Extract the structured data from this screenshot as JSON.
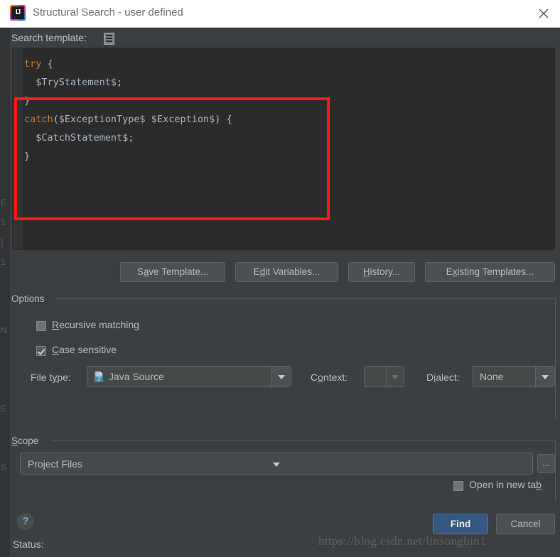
{
  "window": {
    "title": "Structural Search - user defined",
    "logo_alt": "IJ",
    "close_label": "×"
  },
  "search_template": {
    "label": "Search template:",
    "icon": "template-list-icon",
    "code_lines": [
      {
        "segments": [
          {
            "t": "try",
            "c": "kw"
          },
          {
            "t": " {",
            "c": "pn"
          }
        ]
      },
      {
        "segments": [
          {
            "t": "  $TryStatement$",
            "c": "var"
          },
          {
            "t": ";",
            "c": "pn"
          }
        ]
      },
      {
        "segments": [
          {
            "t": "}",
            "c": "pn"
          }
        ]
      },
      {
        "segments": [
          {
            "t": "catch",
            "c": "kw"
          },
          {
            "t": "($ExceptionType$ $Exception$) {",
            "c": "pn"
          }
        ]
      },
      {
        "segments": [
          {
            "t": "  $CatchStatement$",
            "c": "var"
          },
          {
            "t": ";",
            "c": "pn"
          }
        ]
      },
      {
        "segments": [
          {
            "t": "}",
            "c": "pn"
          }
        ]
      }
    ],
    "highlight_color": "#ff1a16"
  },
  "template_buttons": [
    {
      "pre": "S",
      "mnemonic": "a",
      "post": "ve Template..."
    },
    {
      "pre": "E",
      "mnemonic": "d",
      "post": "it Variables..."
    },
    {
      "pre": "",
      "mnemonic": "H",
      "post": "istory..."
    },
    {
      "pre": "E",
      "mnemonic": "x",
      "post": "isting Templates..."
    }
  ],
  "options": {
    "group_title": "Options",
    "recursive": {
      "pre": "",
      "mnemonic": "R",
      "post": "ecursive matching",
      "checked": false
    },
    "case_sensitive": {
      "pre": "",
      "mnemonic": "C",
      "post": "ase sensitive",
      "checked": true
    },
    "file_type": {
      "label_pre": "File t",
      "label_mnemonic": "y",
      "label_post": "pe:",
      "value": "Java Source",
      "icon": "java-source-icon"
    },
    "context": {
      "label_pre": "C",
      "label_mnemonic": "o",
      "label_post": "ntext:",
      "value": "",
      "enabled": false
    },
    "dialect": {
      "label_pre": "D",
      "label_mnemonic": "i",
      "label_post": "alect:",
      "value": "None"
    }
  },
  "scope": {
    "group_title_pre": "",
    "group_title_mnemonic": "S",
    "group_title_post": "cope",
    "value": "Project Files",
    "browse_label": "...",
    "open_in_new_tab": {
      "pre": "Open in new ta",
      "mnemonic": "b",
      "post": "",
      "checked": false
    }
  },
  "footer": {
    "help_label": "?",
    "status_label": "Status:",
    "find_label": "Find",
    "cancel_label": "Cancel",
    "watermark": "https://blog.csdn.net/linsongbin1"
  },
  "background_fragments": [
    "E",
    "1",
    "]",
    "1",
    "N",
    "E",
    "S"
  ],
  "colors": {
    "dialog_bg": "#3c3f41",
    "editor_bg": "#2b2b2b",
    "keyword": "#cc7832",
    "identifier": "#a9b7c6",
    "primary_button": "#365880",
    "highlight": "#ff1a16"
  }
}
